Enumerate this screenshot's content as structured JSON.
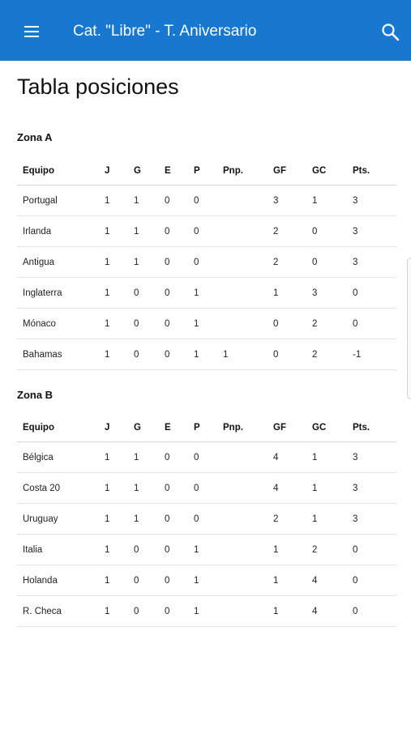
{
  "appbar": {
    "title": "Cat. \"Libre\" - T. Aniversario",
    "menu_icon": "hamburger-menu-icon",
    "search_icon": "search-icon",
    "color": "#1877cf"
  },
  "page_title": "Tabla posiciones",
  "zones": [
    {
      "title": "Zona A",
      "columns": [
        "Equipo",
        "J",
        "G",
        "E",
        "P",
        "Pnp.",
        "GF",
        "GC",
        "Pts."
      ],
      "rows": [
        [
          "Portugal",
          "1",
          "1",
          "0",
          "0",
          "",
          "3",
          "1",
          "3"
        ],
        [
          "Irlanda",
          "1",
          "1",
          "0",
          "0",
          "",
          "2",
          "0",
          "3"
        ],
        [
          "Antigua",
          "1",
          "1",
          "0",
          "0",
          "",
          "2",
          "0",
          "3"
        ],
        [
          "Inglaterra",
          "1",
          "0",
          "0",
          "1",
          "",
          "1",
          "3",
          "0"
        ],
        [
          "Mónaco",
          "1",
          "0",
          "0",
          "1",
          "",
          "0",
          "2",
          "0"
        ],
        [
          "Bahamas",
          "1",
          "0",
          "0",
          "1",
          "1",
          "0",
          "2",
          "-1"
        ]
      ]
    },
    {
      "title": "Zona B",
      "columns": [
        "Equipo",
        "J",
        "G",
        "E",
        "P",
        "Pnp.",
        "GF",
        "GC",
        "Pts."
      ],
      "rows": [
        [
          "Bélgica",
          "1",
          "1",
          "0",
          "0",
          "",
          "4",
          "1",
          "3"
        ],
        [
          "Costa 20",
          "1",
          "1",
          "0",
          "0",
          "",
          "4",
          "1",
          "3"
        ],
        [
          "Uruguay",
          "1",
          "1",
          "0",
          "0",
          "",
          "2",
          "1",
          "3"
        ],
        [
          "Italia",
          "1",
          "0",
          "0",
          "1",
          "",
          "1",
          "2",
          "0"
        ],
        [
          "Holanda",
          "1",
          "0",
          "0",
          "1",
          "",
          "1",
          "4",
          "0"
        ],
        [
          "R. Checa",
          "1",
          "0",
          "0",
          "1",
          "",
          "1",
          "4",
          "0"
        ]
      ]
    }
  ]
}
